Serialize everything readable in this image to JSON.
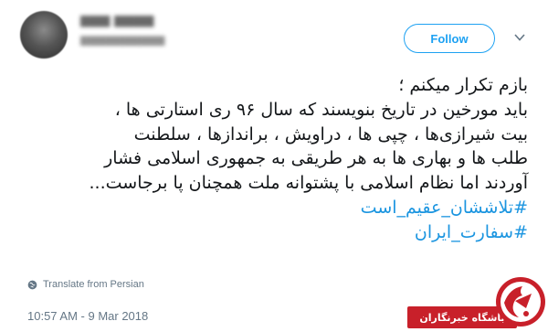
{
  "tweet": {
    "follow_label": "Follow",
    "lines": [
      "بازم تکرار میکنم ؛",
      "باید مورخین در تاریخ بنویسند که سال ۹۶ ری استارتی ها ،",
      "بیت شیرازی‌ها ، چپی ها ، دراویش ، براندازها ، سلطنت",
      "طلب ها و بهاری ها به هر طریقی به جمهوری اسلامی فشار",
      "آوردند اما نظام اسلامی با پشتوانه ملت همچنان پا برجاست..."
    ],
    "hashtags": [
      "#تلاششان_عقیم_است",
      "#سفارت_ایران"
    ],
    "translate_label": "Translate from Persian",
    "timestamp": "10:57 AM - 9 Mar 2018"
  },
  "watermark": {
    "text": "باشگاه خبرنگاران"
  },
  "colors": {
    "accent": "#1da1f2",
    "hashtag": "#1b95e0",
    "muted": "#657786",
    "watermark_red": "#c8202a"
  },
  "icons": {
    "more": "chevron-down-icon",
    "translate": "globe-icon"
  }
}
